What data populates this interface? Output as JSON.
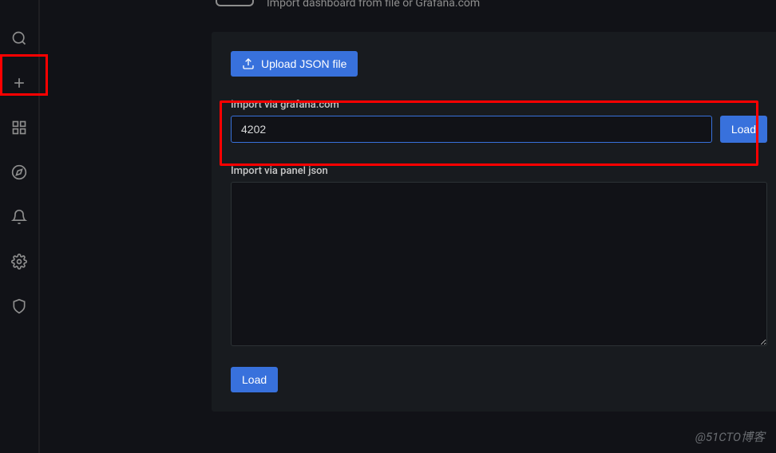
{
  "header": {
    "subtitle": "Import dashboard from file or Grafana.com"
  },
  "content": {
    "upload_button": "Upload JSON file",
    "grafana_section": {
      "label": "Import via grafana.com",
      "value": "4202",
      "load_button": "Load"
    },
    "panel_json_section": {
      "label": "Import via panel json",
      "value": ""
    },
    "bottom_load_button": "Load"
  },
  "watermark": "@51CTO博客"
}
